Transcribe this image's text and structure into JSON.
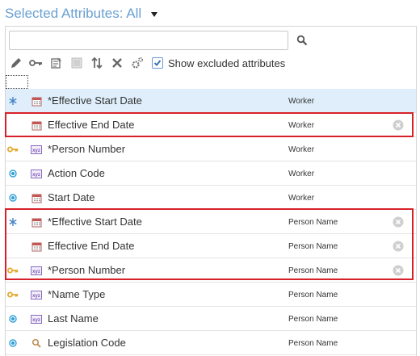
{
  "header": {
    "title": "Selected Attributes: All"
  },
  "search": {
    "value": "",
    "placeholder": ""
  },
  "toolbar": {
    "show_excluded_label": "Show excluded attributes",
    "show_excluded_checked": true
  },
  "colors": {
    "accent": "#6aa0d2",
    "selected_row": "#dfeefa",
    "highlight": "#d8202a",
    "key": "#e3a92c"
  },
  "rows": [
    {
      "name": "*Effective Start Date",
      "object": "Worker",
      "indicator": "asterisk-indicator-icon",
      "type": "calendar-icon",
      "removable": false,
      "selected": true
    },
    {
      "name": "Effective End Date",
      "object": "Worker",
      "indicator": "",
      "type": "calendar-icon",
      "removable": true,
      "selected": false
    },
    {
      "name": "*Person Number",
      "object": "Worker",
      "indicator": "key-icon",
      "type": "text-type-icon",
      "removable": false,
      "selected": false
    },
    {
      "name": "Action Code",
      "object": "Worker",
      "indicator": "required-dot-icon",
      "type": "text-type-icon",
      "removable": false,
      "selected": false
    },
    {
      "name": "Start Date",
      "object": "Worker",
      "indicator": "required-dot-icon",
      "type": "calendar-icon",
      "removable": false,
      "selected": false
    },
    {
      "name": "*Effective Start Date",
      "object": "Person Name",
      "indicator": "asterisk-indicator-icon",
      "type": "calendar-icon",
      "removable": true,
      "selected": false
    },
    {
      "name": "Effective End Date",
      "object": "Person Name",
      "indicator": "",
      "type": "calendar-icon",
      "removable": true,
      "selected": false
    },
    {
      "name": "*Person Number",
      "object": "Person Name",
      "indicator": "key-icon",
      "type": "text-type-icon",
      "removable": true,
      "selected": false
    },
    {
      "name": "*Name Type",
      "object": "Person Name",
      "indicator": "key-icon",
      "type": "text-type-icon",
      "removable": false,
      "selected": false
    },
    {
      "name": "Last Name",
      "object": "Person Name",
      "indicator": "required-dot-icon",
      "type": "text-type-icon",
      "removable": false,
      "selected": false
    },
    {
      "name": "Legislation Code",
      "object": "Person Name",
      "indicator": "required-dot-icon",
      "type": "lookup-icon",
      "removable": false,
      "selected": false
    }
  ]
}
